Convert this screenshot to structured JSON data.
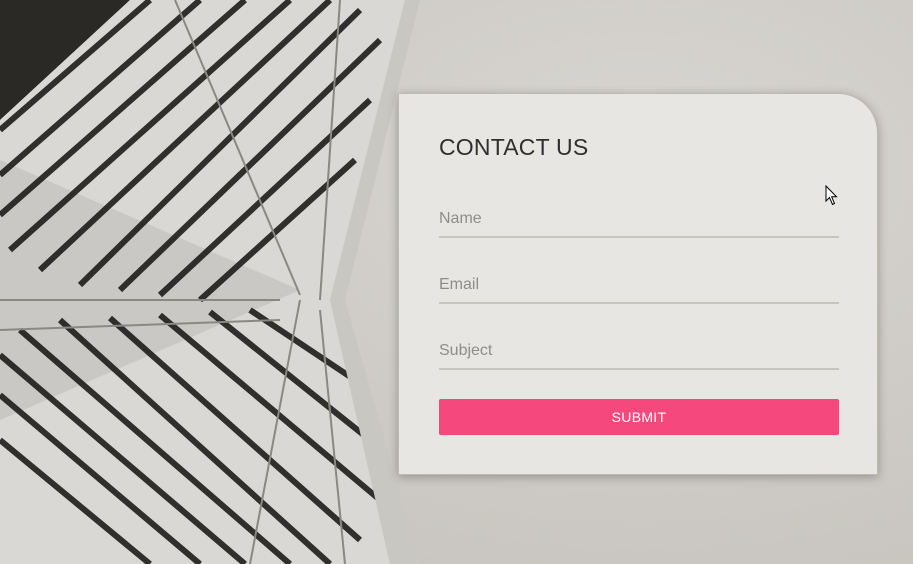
{
  "form": {
    "title": "CONTACT US",
    "name_placeholder": "Name",
    "email_placeholder": "Email",
    "subject_placeholder": "Subject",
    "submit_label": "SUBMIT"
  },
  "colors": {
    "accent": "#f5497d",
    "card": "#e8e6e2",
    "background": "#cfccc7"
  }
}
